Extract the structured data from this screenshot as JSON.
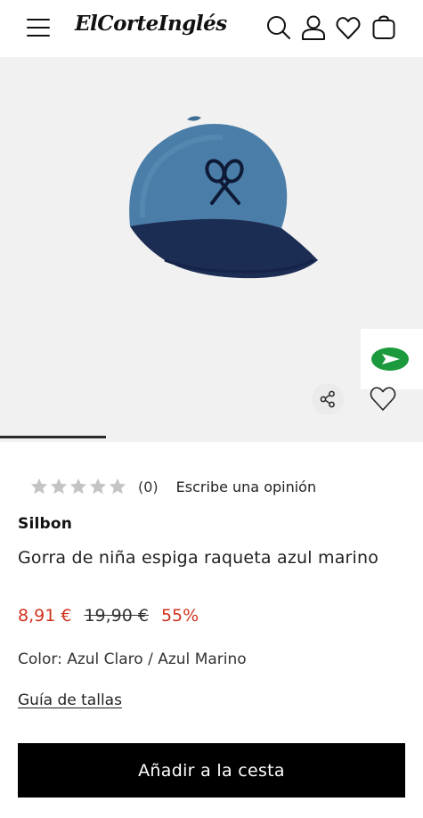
{
  "header": {
    "logo_text": "ElCorteInglés",
    "icons": [
      "menu-icon",
      "search-icon",
      "user-icon",
      "heart-icon",
      "bag-icon"
    ]
  },
  "gallery": {
    "image_subject": "cap",
    "slide_progress": 0.25,
    "icons": [
      "whatsapp-icon",
      "share-icon",
      "heart-outline-icon"
    ]
  },
  "product": {
    "rating": {
      "stars_filled": 0,
      "stars_total": 5,
      "count": "(0)",
      "write_review": "Escribe una opinión"
    },
    "brand": "Silbon",
    "title": "Gorra de niña espiga raqueta azul marino",
    "price_current": "8,91 €",
    "price_original": "19,90 €",
    "discount": "55%",
    "color_label": "Color: Azul Claro / Azul Marino",
    "size_guide": "Guía de tallas",
    "add_to_cart": "Añadir a la cesta"
  },
  "colors": {
    "sale_red": "#d0321e",
    "button_black": "#000000",
    "whatsapp_green": "#1a9a3c",
    "gallery_bg": "#f1f1f1"
  }
}
